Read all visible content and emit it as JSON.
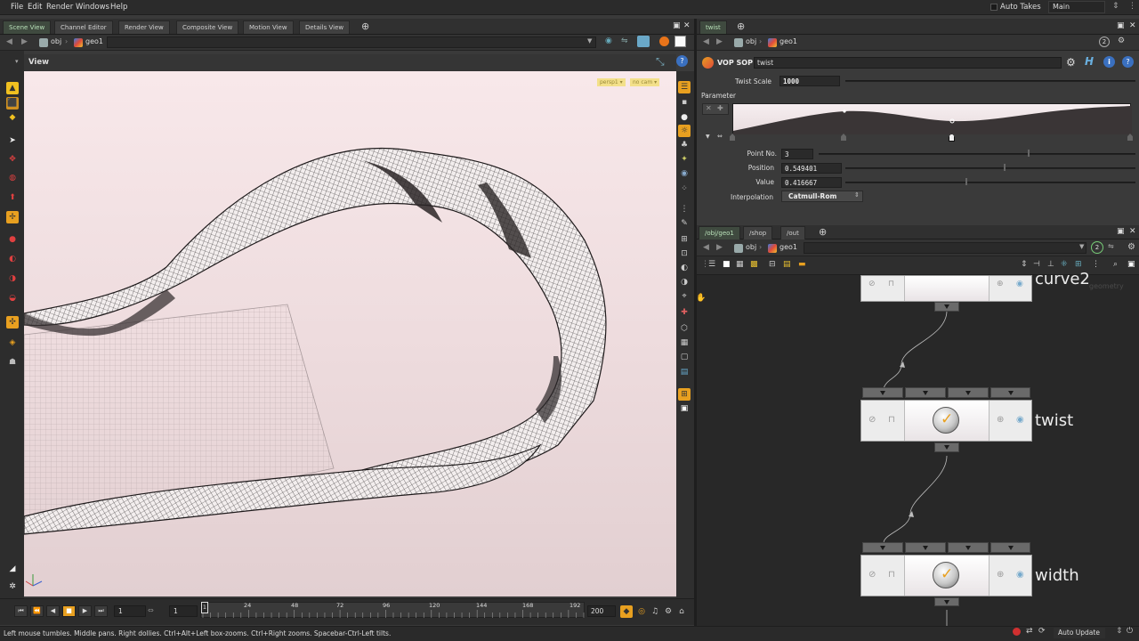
{
  "menu": {
    "items": [
      "File",
      "Edit",
      "Render",
      "Windows",
      "Help"
    ],
    "auto_takes": "Auto Takes",
    "desktop": "Main"
  },
  "left_tabs": [
    "Scene View",
    "Channel Editor",
    "Render View",
    "Composite View",
    "Motion View",
    "Details View"
  ],
  "left_path": {
    "root": "obj",
    "node": "geo1"
  },
  "viewport": {
    "label": "View",
    "camera_tags": [
      "persp1 ▾",
      "no cam ▾"
    ],
    "background_top": "#f8e8ea",
    "background_bottom": "#e2cfd1"
  },
  "timeline": {
    "start_frame": "1",
    "current_frame": "1",
    "end_frame": "200",
    "ruler_start": "1",
    "ticks": [
      "24",
      "48",
      "72",
      "96",
      "120",
      "144",
      "168",
      "192"
    ]
  },
  "status": "Left mouse tumbles. Middle pans. Right dollies. Ctrl+Alt+Left box-zooms. Ctrl+Right zooms. Spacebar-Ctrl-Left tilts.",
  "param_tab": "twist",
  "param_path": {
    "root": "obj",
    "node": "geo1"
  },
  "param": {
    "op_type": "VOP SOP",
    "op_name": "twist",
    "twist_scale_label": "Twist Scale",
    "twist_scale": "1000",
    "section": "Parameter",
    "point_no_label": "Point No.",
    "point_no": "3",
    "position_label": "Position",
    "position": "0.549401",
    "value_label": "Value",
    "value": "0.416667",
    "interp_label": "Interpolation",
    "interp": "Catmull-Rom"
  },
  "net_tabs": [
    "/obj/geo1",
    "/shop",
    "/out"
  ],
  "net_path": {
    "root": "obj",
    "node": "geo1"
  },
  "net_badge": "2",
  "nodes": [
    {
      "name": "curve2",
      "sub": "geometry"
    },
    {
      "name": "twist"
    },
    {
      "name": "width"
    }
  ],
  "auto_update": "Auto Update",
  "colors": {
    "accent_orange": "#e8a020",
    "active_tab_green": "#b8e0b8",
    "mesh_dark": "#1e1a1b"
  }
}
